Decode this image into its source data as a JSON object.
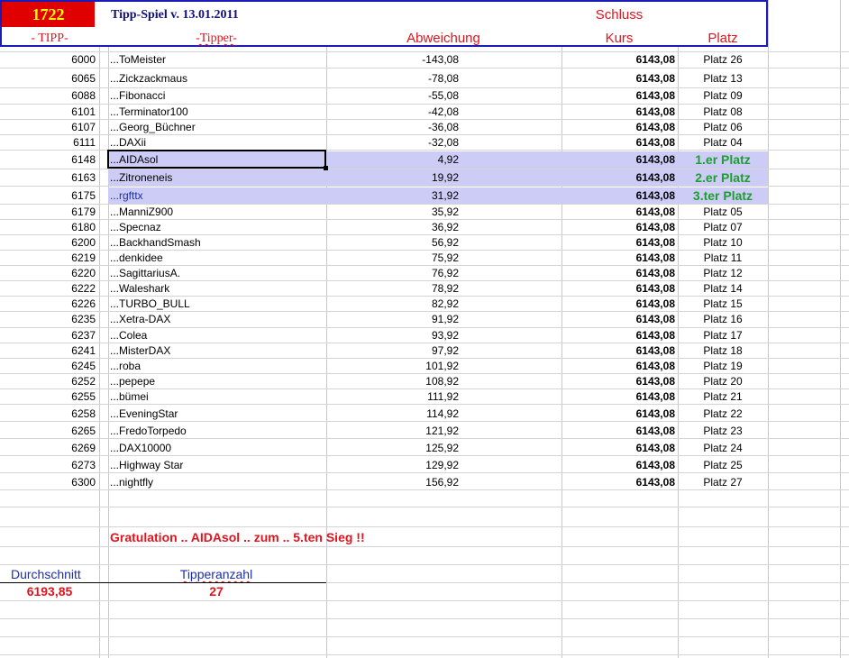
{
  "header": {
    "count_badge": "1722",
    "title": "Tipp-Spiel v. 13.01.2011",
    "schluss": "Schluss",
    "col_tipp": "- TIPP-",
    "col_tipper": "-Tipper-",
    "col_abweichung": "Abweichung",
    "col_kurs": "Kurs",
    "col_platz": "Platz"
  },
  "rows": [
    {
      "tipp": "6000",
      "tipper": "...ToMeister",
      "abw": "-143,08",
      "kurs": "6143,08",
      "platz": "Platz 26"
    },
    {
      "tipp": "6065",
      "tipper": "...Zickzackmaus",
      "abw": "-78,08",
      "kurs": "6143,08",
      "platz": "Platz 13"
    },
    {
      "tipp": "6088",
      "tipper": "...Fibonacci",
      "abw": "-55,08",
      "kurs": "6143,08",
      "platz": "Platz 09"
    },
    {
      "tipp": "6101",
      "tipper": "...Terminator100",
      "abw": "-42,08",
      "kurs": "6143,08",
      "platz": "Platz 08"
    },
    {
      "tipp": "6107",
      "tipper": "...Georg_Büchner",
      "abw": "-36,08",
      "kurs": "6143,08",
      "platz": "Platz 06"
    },
    {
      "tipp": "6111",
      "tipper": "...DAXii",
      "abw": "-32,08",
      "kurs": "6143,08",
      "platz": "Platz 04"
    },
    {
      "tipp": "6148",
      "tipper": "...AIDAsol",
      "abw": "4,92",
      "kurs": "6143,08",
      "platz": "1.er Platz",
      "winner": true
    },
    {
      "tipp": "6163",
      "tipper": "...Zitroneneis",
      "abw": "19,92",
      "kurs": "6143,08",
      "platz": "2.er Platz",
      "winner": true
    },
    {
      "tipp": "6175",
      "tipper": "...rgfttx",
      "abw": "31,92",
      "kurs": "6143,08",
      "platz": "3.ter Platz",
      "winner": true
    },
    {
      "tipp": "6179",
      "tipper": "...ManniZ900",
      "abw": "35,92",
      "kurs": "6143,08",
      "platz": "Platz 05"
    },
    {
      "tipp": "6180",
      "tipper": "...Specnaz",
      "abw": "36,92",
      "kurs": "6143,08",
      "platz": "Platz 07"
    },
    {
      "tipp": "6200",
      "tipper": "...BackhandSmash",
      "abw": "56,92",
      "kurs": "6143,08",
      "platz": "Platz 10"
    },
    {
      "tipp": "6219",
      "tipper": "...denkidee",
      "abw": "75,92",
      "kurs": "6143,08",
      "platz": "Platz 11"
    },
    {
      "tipp": "6220",
      "tipper": "...SagittariusA.",
      "abw": "76,92",
      "kurs": "6143,08",
      "platz": "Platz 12"
    },
    {
      "tipp": "6222",
      "tipper": "...Waleshark",
      "abw": "78,92",
      "kurs": "6143,08",
      "platz": "Platz 14"
    },
    {
      "tipp": "6226",
      "tipper": "...TURBO_BULL",
      "abw": "82,92",
      "kurs": "6143,08",
      "platz": "Platz 15"
    },
    {
      "tipp": "6235",
      "tipper": "...Xetra-DAX",
      "abw": "91,92",
      "kurs": "6143,08",
      "platz": "Platz 16"
    },
    {
      "tipp": "6237",
      "tipper": "...Colea",
      "abw": "93,92",
      "kurs": "6143,08",
      "platz": "Platz 17"
    },
    {
      "tipp": "6241",
      "tipper": "...MisterDAX",
      "abw": "97,92",
      "kurs": "6143,08",
      "platz": "Platz 18"
    },
    {
      "tipp": "6245",
      "tipper": "...roba",
      "abw": "101,92",
      "kurs": "6143,08",
      "platz": "Platz 19"
    },
    {
      "tipp": "6252",
      "tipper": "...pepepe",
      "abw": "108,92",
      "kurs": "6143,08",
      "platz": "Platz 20"
    },
    {
      "tipp": "6255",
      "tipper": "...bümei",
      "abw": "111,92",
      "kurs": "6143,08",
      "platz": "Platz 21"
    },
    {
      "tipp": "6258",
      "tipper": "...EveningStar",
      "abw": "114,92",
      "kurs": "6143,08",
      "platz": "Platz 22"
    },
    {
      "tipp": "6265",
      "tipper": "...FredoTorpedo",
      "abw": "121,92",
      "kurs": "6143,08",
      "platz": "Platz 23"
    },
    {
      "tipp": "6269",
      "tipper": "...DAX10000",
      "abw": "125,92",
      "kurs": "6143,08",
      "platz": "Platz 24"
    },
    {
      "tipp": "6273",
      "tipper": "...Highway Star",
      "abw": "129,92",
      "kurs": "6143,08",
      "platz": "Platz 25"
    },
    {
      "tipp": "6300",
      "tipper": "...nightfly",
      "abw": "156,92",
      "kurs": "6143,08",
      "platz": "Platz 27"
    }
  ],
  "congrats": "Gratulation .. AIDAsol .. zum .. 5.ten Sieg !!",
  "summary": {
    "avg_label": "Durchschnitt",
    "avg_value": "6193,85",
    "count_label": "Tipperanzahl",
    "count_value": "27"
  },
  "colors": {
    "highlight": "#ccccf7",
    "accent_red": "#e0141e",
    "accent_blue": "#101080",
    "winner_green": "#1e9e2e",
    "badge_bg": "#e00000",
    "badge_text": "#ffff00"
  }
}
